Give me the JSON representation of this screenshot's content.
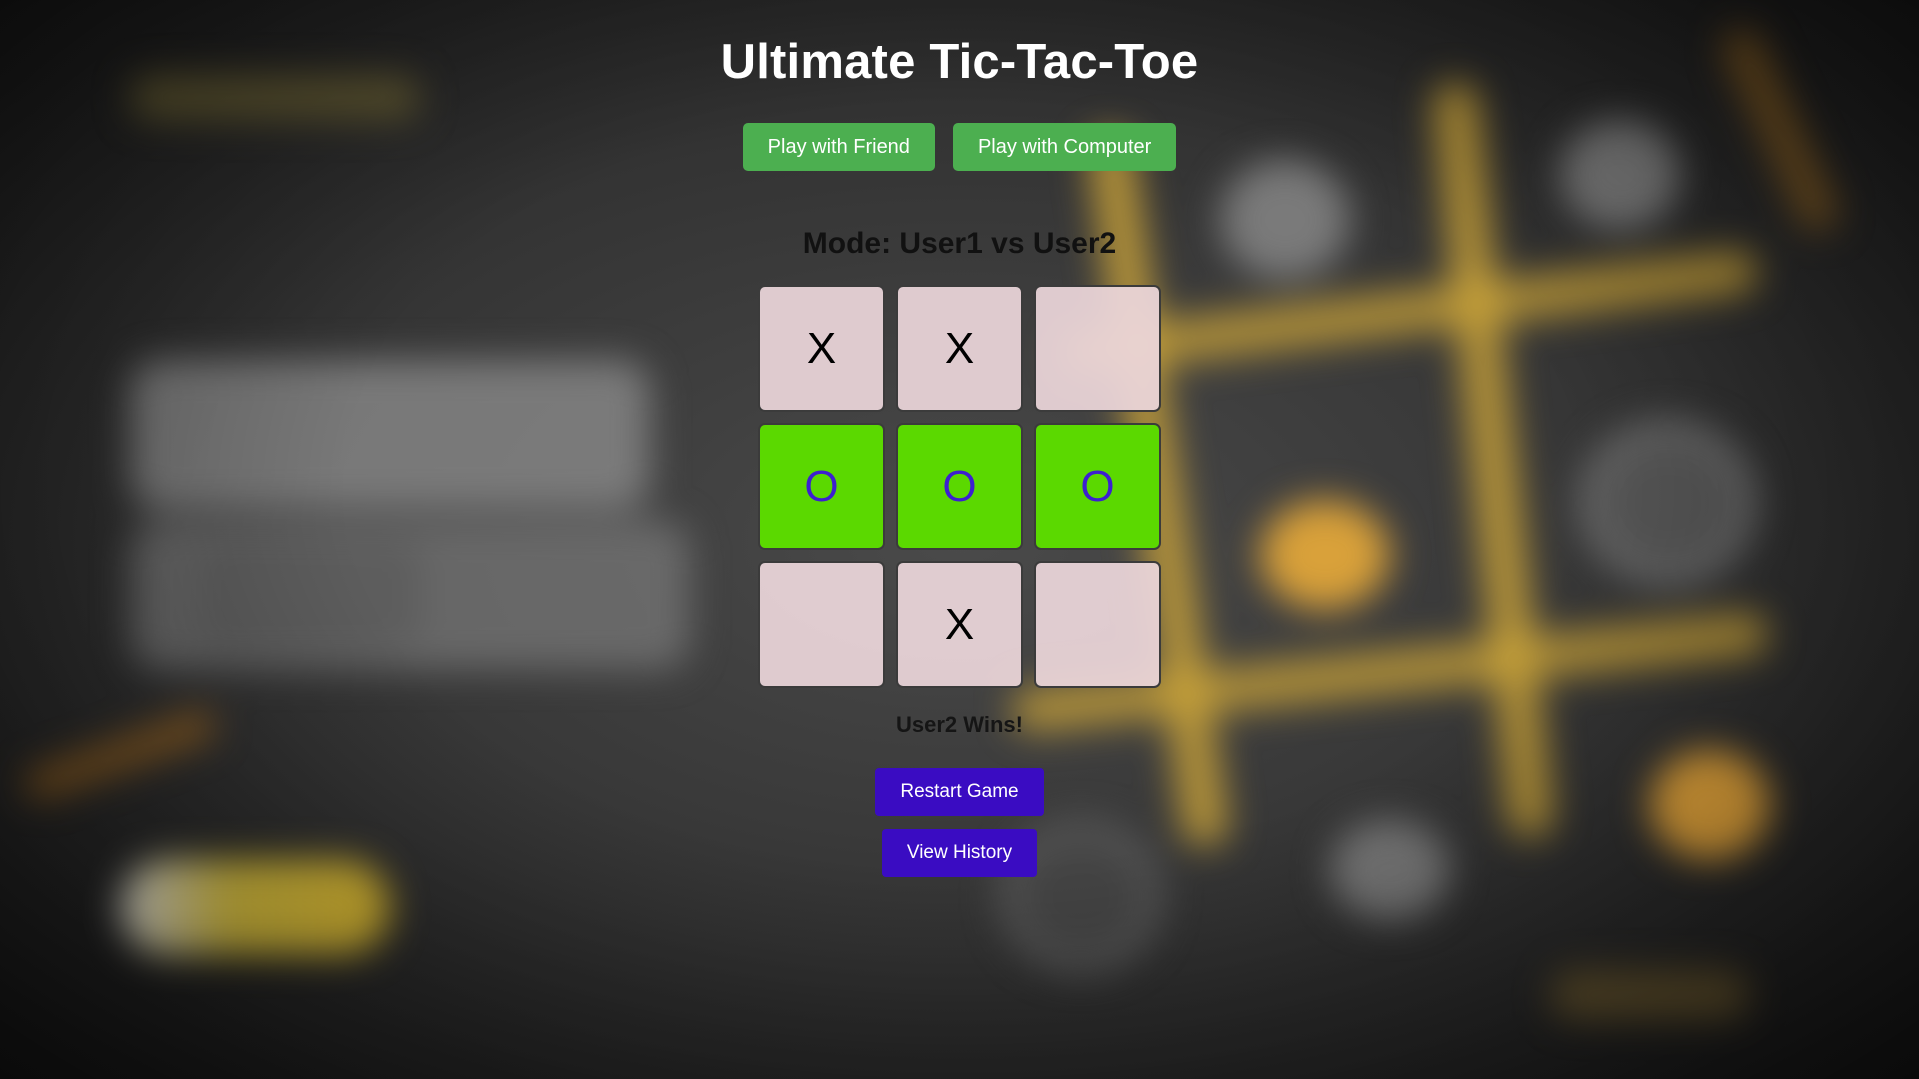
{
  "title": "Ultimate Tic-Tac-Toe",
  "mode_buttons": {
    "friend_label": "Play with Friend",
    "computer_label": "Play with Computer"
  },
  "mode_text": "Mode: User1 vs User2",
  "board": {
    "cells": [
      "X",
      "X",
      "",
      "O",
      "O",
      "O",
      "",
      "X",
      ""
    ],
    "winning_cells": [
      3,
      4,
      5
    ]
  },
  "status": "User2 Wins!",
  "actions": {
    "restart_label": "Restart Game",
    "history_label": "View History"
  },
  "colors": {
    "friend_button": "#4caf50",
    "computer_button": "#4caf50",
    "action_button": "#3a0cc2",
    "cell_default": "#ecd6da",
    "cell_winning": "#5bd900",
    "winning_mark": "#3d1fd0"
  }
}
